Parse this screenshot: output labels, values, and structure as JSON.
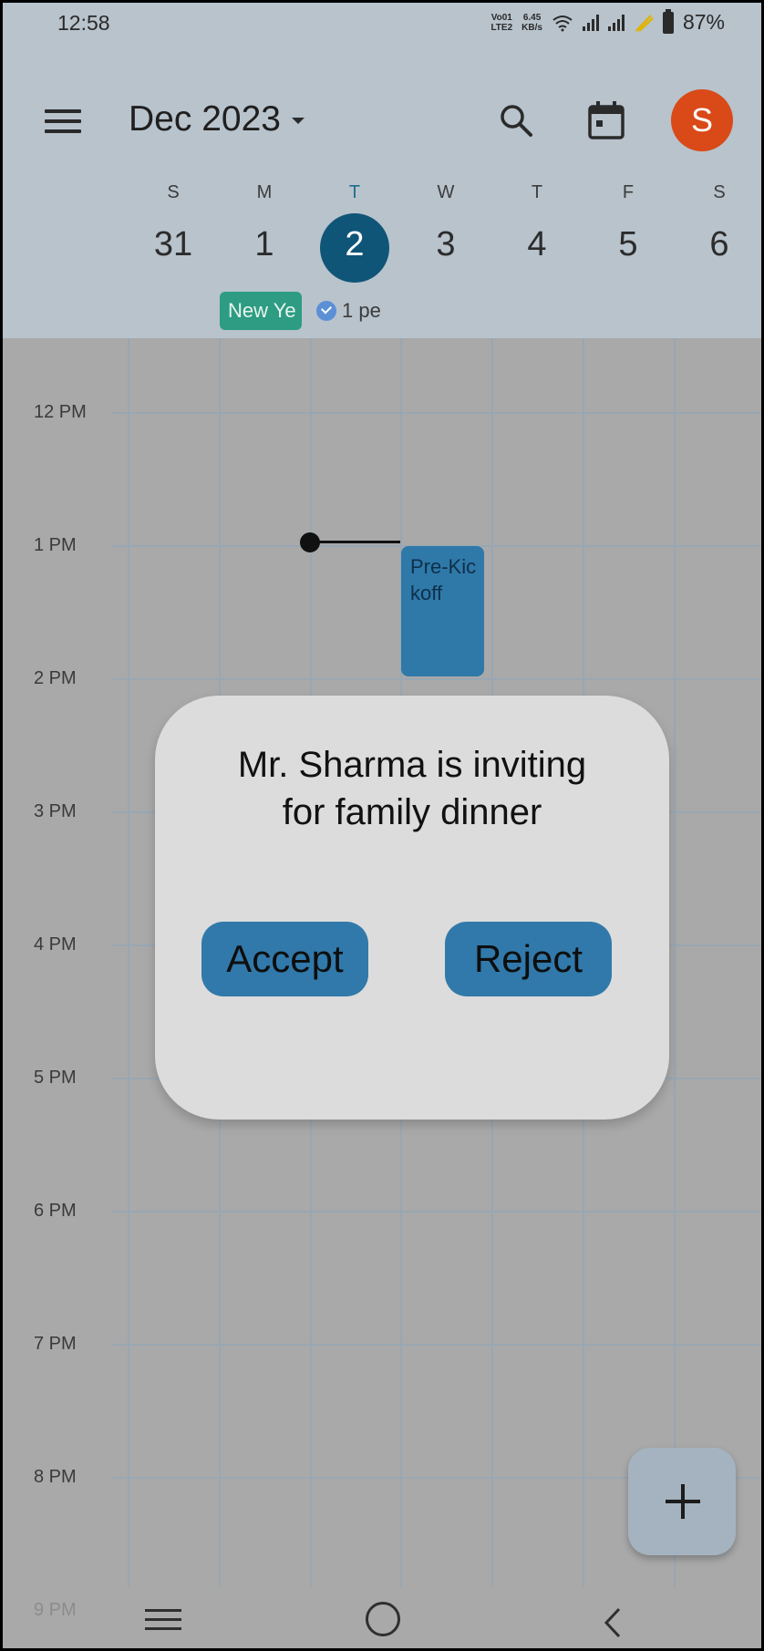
{
  "status_bar": {
    "time": "12:58",
    "network_top": "Vo01",
    "network_bottom": "LTE2",
    "speed_top": "6.45",
    "speed_bottom": "KB/s",
    "battery": "87%"
  },
  "toolbar": {
    "month": "Dec 2023"
  },
  "week": [
    {
      "letter": "S",
      "date": "31"
    },
    {
      "letter": "M",
      "date": "1"
    },
    {
      "letter": "T",
      "date": "2"
    },
    {
      "letter": "W",
      "date": "3"
    },
    {
      "letter": "T",
      "date": "4"
    },
    {
      "letter": "F",
      "date": "5"
    },
    {
      "letter": "S",
      "date": "6"
    }
  ],
  "avatar_initial": "S",
  "all_day": {
    "holiday_chip": "New Ye",
    "more_chip": "1 pe"
  },
  "hours": [
    "12 PM",
    "1 PM",
    "2 PM",
    "3 PM",
    "4 PM",
    "5 PM",
    "6 PM",
    "7 PM",
    "8 PM",
    "9 PM"
  ],
  "event": {
    "title": "Pre-Kickoff"
  },
  "dialog": {
    "line1": "Mr. Sharma is inviting",
    "line2": "for family dinner",
    "accept": "Accept",
    "reject": "Reject"
  }
}
